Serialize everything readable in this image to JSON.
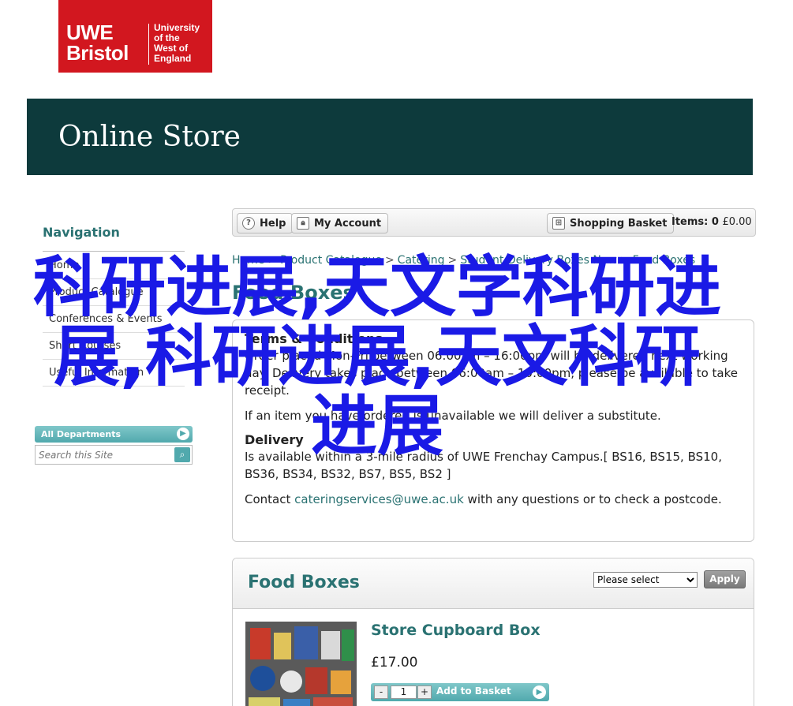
{
  "logo": {
    "big_line1": "UWE",
    "big_line2": "Bristol",
    "small_lines": [
      "University",
      "of the",
      "West of",
      "England"
    ]
  },
  "banner": {
    "title": "Online Store"
  },
  "nav": {
    "heading": "Navigation",
    "items": [
      {
        "label": "Home"
      },
      {
        "label": "Product Catalogue"
      },
      {
        "label": "Conferences & Events"
      },
      {
        "label": "Short Courses",
        "chevron": "›"
      },
      {
        "label": "Useful Information"
      }
    ],
    "departments_label": "All Departments",
    "search_placeholder": "Search this Site"
  },
  "toolbar": {
    "help_label": "Help",
    "account_label": "My Account",
    "basket_label": "Shopping Basket",
    "items_label": "Items:",
    "items_count": "0",
    "items_amount": "£0.00"
  },
  "breadcrumb": [
    "Home",
    "Product Catalogue",
    "Catering",
    "Student Delivery Boxes New",
    "Food Boxes"
  ],
  "page_title": "Food Boxes",
  "info": {
    "terms_heading": "Terms & Conditions",
    "terms_text": "Order placed Mon-Fri between 06:00am – 16:00pm will be delivered next working day. Delivery takes place between 06:00am – 10:00pm, please be available to take receipt.",
    "substitute_text": "If an item you have ordered is unavailable we will deliver a substitute.",
    "delivery_heading": "Delivery",
    "delivery_text": "Is available within a 3-mile radius of UWE Frenchay Campus.[ BS16, BS15, BS10, BS36, BS34, BS32, BS7, BS5, BS2 ]",
    "contact_prefix": "Contact ",
    "contact_email": "cateringservices@uwe.ac.uk",
    "contact_suffix": " with any questions or to check a postcode."
  },
  "food_boxes": {
    "title": "Food Boxes",
    "select_value": "Please select",
    "apply_label": "Apply",
    "product": {
      "name": "Store Cupboard Box",
      "price": "£17.00",
      "quantity": "1",
      "add_label": "Add to Basket"
    }
  },
  "overlay_text": "科研进展,天文学科研进展,科研进展,天文科研进展",
  "colors": {
    "banner": "#0d3a3c",
    "accent": "#2a7272",
    "logo_red": "#d2171f",
    "overlay": "#1a1ae6"
  }
}
